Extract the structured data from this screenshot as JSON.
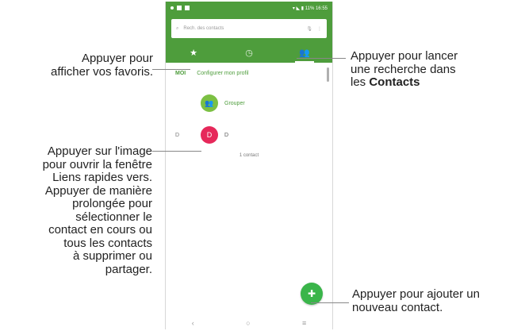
{
  "phone": {
    "status_right": "▾ ◣ ▮ 11% 16:55",
    "search_placeholder": "Rech. des contacts",
    "tabs": [
      {
        "icon": "star-icon",
        "glyph": "★"
      },
      {
        "icon": "clock-icon",
        "glyph": "◷"
      },
      {
        "icon": "people-icon",
        "glyph": "👥"
      }
    ],
    "me_tag": "MOI",
    "me_link": "Configurer mon profil",
    "group_label": "Grouper",
    "section_letter": "D",
    "contact_initial": "D",
    "contact_name": "D",
    "contact_count": "1 contact",
    "nav": {
      "back": "‹",
      "home": "○",
      "menu": "≡"
    }
  },
  "callouts": {
    "favorites": [
      "Appuyer pour",
      "afficher vos favoris."
    ],
    "search_line1": "Appuyer pour lancer",
    "search_line2": "une recherche dans",
    "search_line3_prefix": "les ",
    "search_line3_bold": "Contacts",
    "image_lines": [
      "Appuyer sur l'image",
      "pour ouvrir la fenêtre",
      "Liens rapides vers.",
      "Appuyer de manière",
      "prolongée pour",
      "sélectionner le",
      "contact en cours ou",
      "tous les contacts",
      "à supprimer ou",
      "partager."
    ],
    "add": [
      "Appuyer pour ajouter un",
      "nouveau contact."
    ]
  },
  "colors": {
    "green": "#4e9d3c",
    "fab": "#3ab54a",
    "pink": "#e6285a"
  }
}
